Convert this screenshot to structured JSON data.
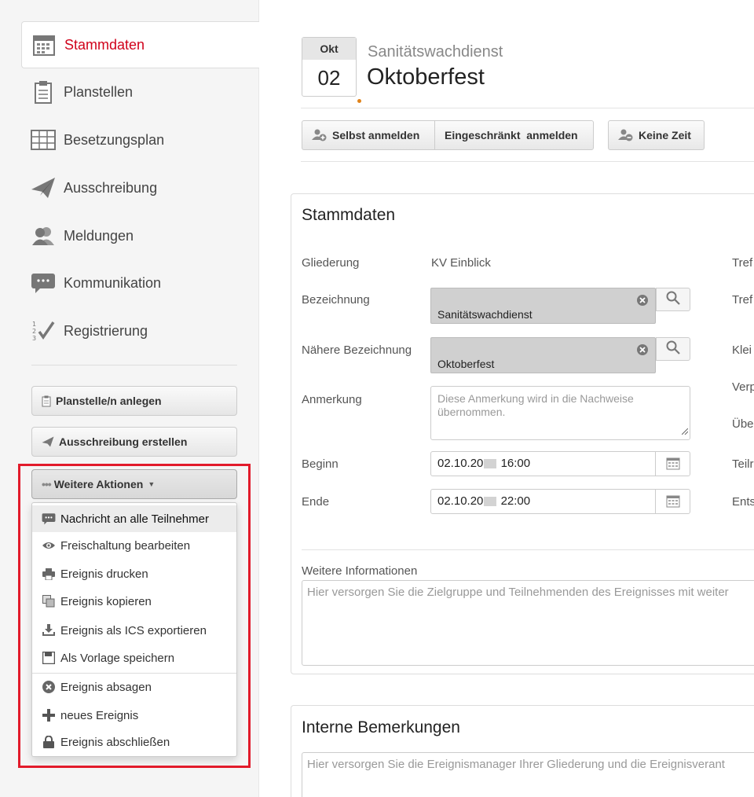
{
  "sidebar": {
    "nav": [
      {
        "label": "Stammdaten",
        "icon": "calendar-icon",
        "active": true
      },
      {
        "label": "Planstellen",
        "icon": "clipboard-icon"
      },
      {
        "label": "Besetzungsplan",
        "icon": "grid-icon"
      },
      {
        "label": "Ausschreibung",
        "icon": "paper-plane-icon"
      },
      {
        "label": "Meldungen",
        "icon": "users-icon"
      },
      {
        "label": "Kommunikation",
        "icon": "chat-icon"
      },
      {
        "label": "Registrierung",
        "icon": "checklist-icon"
      }
    ],
    "buttons": {
      "planstelle": "Planstelle/n anlegen",
      "ausschreibung": "Ausschreibung erstellen",
      "weitere": "Weitere Aktionen"
    },
    "menu": [
      {
        "label": "Nachricht an alle Teilnehmer",
        "icon": "chat-icon"
      },
      {
        "label": "Freischaltung bearbeiten",
        "icon": "eye-icon"
      },
      {
        "label": "Ereignis drucken",
        "icon": "printer-icon"
      },
      {
        "label": "Ereignis kopieren",
        "icon": "copy-icon"
      },
      {
        "label": "Ereignis als ICS exportieren",
        "icon": "download-icon"
      },
      {
        "label": "Als Vorlage speichern",
        "icon": "save-icon"
      },
      {
        "label": "Ereignis absagen",
        "icon": "cancel-icon"
      },
      {
        "label": "neues Ereignis",
        "icon": "plus-icon"
      },
      {
        "label": "Ereignis abschließen",
        "icon": "lock-icon"
      }
    ]
  },
  "event": {
    "month": "Okt",
    "day": "02",
    "category": "Sanitätswachdienst",
    "title": "Oktoberfest"
  },
  "actions": {
    "selbst": "Selbst anmelden",
    "eingeschraenkt": "Eingeschränkt  anmelden",
    "keine_zeit": "Keine Zeit"
  },
  "stammdaten": {
    "title": "Stammdaten",
    "gliederung_label": "Gliederung",
    "gliederung_value": "KV Einblick",
    "bezeichnung_label": "Bezeichnung",
    "bezeichnung_value": "Sanitätswachdienst",
    "naehere_label": "Nähere Bezeichnung",
    "naehere_value": "Oktoberfest",
    "anmerkung_label": "Anmerkung",
    "anmerkung_placeholder": "Diese Anmerkung wird in die Nachweise übernommen.",
    "beginn_label": "Beginn",
    "beginn_date": "02.10.20",
    "beginn_time": "16:00",
    "ende_label": "Ende",
    "ende_date": "02.10.20",
    "ende_time": "22:00",
    "right_labels": [
      "Tref",
      "Tref",
      "Klei",
      "Verp",
      "Übe",
      "Teilr",
      "Ents"
    ],
    "weitere_label": "Weitere Informationen",
    "weitere_placeholder": "Hier versorgen Sie die Zielgruppe und Teilnehmenden des Ereignisses mit weiter"
  },
  "intern": {
    "title": "Interne Bemerkungen",
    "placeholder": "Hier versorgen Sie die Ereignismanager Ihrer Gliederung und die Ereignisverant"
  },
  "colors": {
    "active": "#d0021b",
    "highlight": "#e21b2b",
    "date_dot": "#e0831a"
  }
}
